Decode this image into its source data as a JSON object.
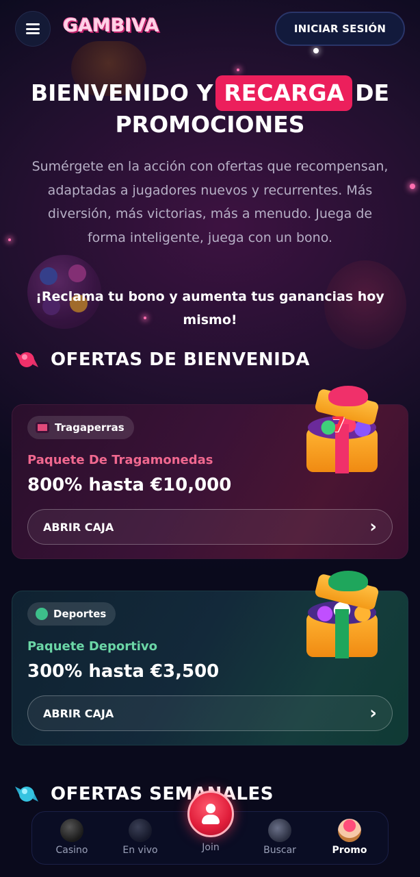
{
  "header": {
    "logo_text": "GAMBIVA",
    "login_label": "INICIAR SESIÓN"
  },
  "hero": {
    "title_part1": "BIENVENIDO Y",
    "title_highlight": "RECARGA",
    "title_part2": "DE",
    "title_line2": "PROMOCIONES",
    "description": "Sumérgete en la acción con ofertas que recompensan, adaptadas a jugadores nuevos y recurrentes. Más diversión, más victorias, más a menudo. Juega de forma inteligente, juega con un bono.",
    "cta_text": "¡Reclama tu bono y aumenta tus ganancias hoy mismo!"
  },
  "sections": {
    "welcome_title": "OFERTAS DE BIENVENIDA",
    "weekly_title": "OFERTAS SEMANALES"
  },
  "offers": [
    {
      "tag": "Tragaperras",
      "subtitle": "Paquete De Tragamonedas",
      "amount": "800% hasta €10,000",
      "button": "ABRIR CAJA",
      "accent": "#f0688f"
    },
    {
      "tag": "Deportes",
      "subtitle": "Paquete Deportivo",
      "amount": "300% hasta €3,500",
      "button": "ABRIR CAJA",
      "accent": "#6bd6a6"
    }
  ],
  "bottom_nav": {
    "items": [
      {
        "label": "Casino",
        "icon": "bomb-icon"
      },
      {
        "label": "En vivo",
        "icon": "spade-icon"
      },
      {
        "label": "Join",
        "icon": "user-icon"
      },
      {
        "label": "Buscar",
        "icon": "search-icon"
      },
      {
        "label": "Promo",
        "icon": "cupcake-icon"
      }
    ],
    "active": "Promo"
  },
  "colors": {
    "highlight": "#ec1f5c",
    "background": "#0c0b1f"
  }
}
